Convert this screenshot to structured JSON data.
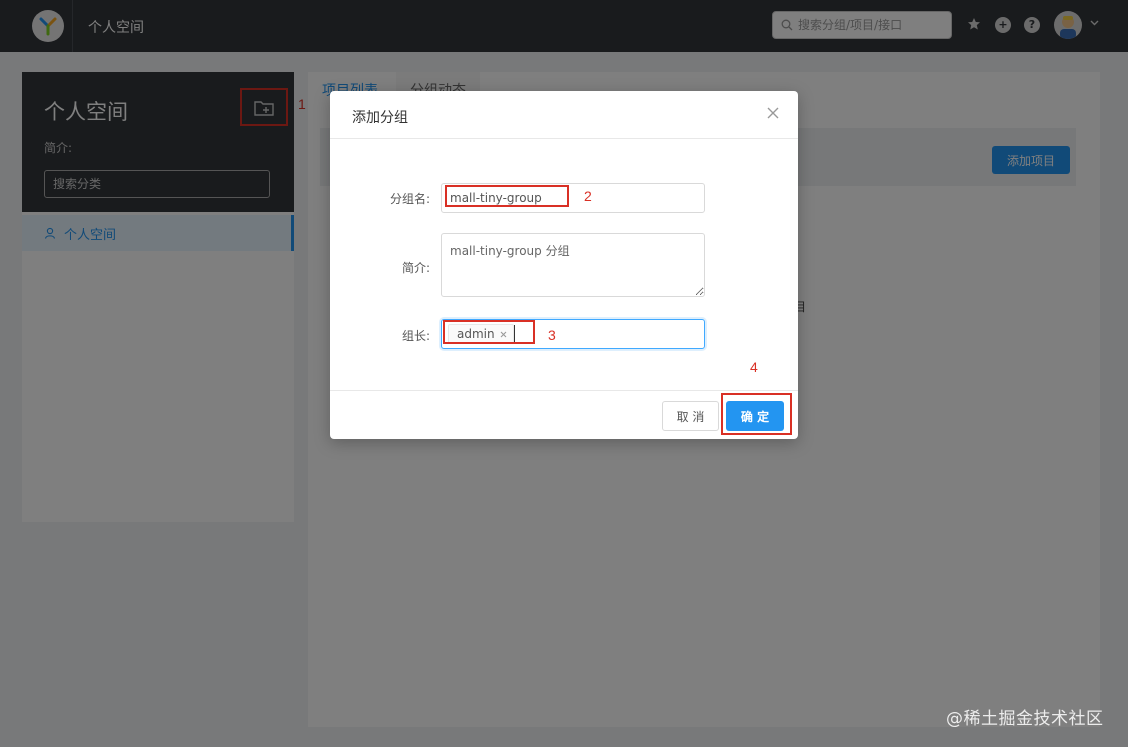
{
  "header": {
    "title": "个人空间",
    "search_placeholder": "搜索分组/项目/接口",
    "icons": [
      "yapi-logo-icon",
      "search-icon",
      "star-icon",
      "plus-circle-icon",
      "help-circle-icon",
      "avatar",
      "chevron-down-icon"
    ],
    "plus_glyph": "+",
    "help_glyph": "?"
  },
  "sidebar": {
    "title": "个人空间",
    "desc_label": "简介:",
    "search_placeholder": "搜索分类",
    "items": [
      {
        "label": "个人空间",
        "icon": "user-icon",
        "active": true
      }
    ]
  },
  "main": {
    "tabs": [
      {
        "label": "项目列表"
      },
      {
        "label": "分组动态"
      }
    ],
    "add_project_label": "添加项目",
    "stray_text": "目"
  },
  "modal": {
    "title": "添加分组",
    "fields": {
      "group_name": {
        "label": "分组名:",
        "value": "mall-tiny-group"
      },
      "desc": {
        "label": "简介:",
        "value": "mall-tiny-group 分组"
      },
      "owner": {
        "label": "组长:",
        "tags": [
          "admin"
        ]
      }
    },
    "cancel_label": "取 消",
    "ok_label": "确 定"
  },
  "annotations": {
    "step1": "1",
    "step2": "2",
    "step3": "3",
    "step4": "4",
    "color": "#d93025"
  },
  "colors": {
    "accent": "#2395f1",
    "header_bg": "#32363a"
  },
  "watermark": "@稀土掘金技术社区"
}
